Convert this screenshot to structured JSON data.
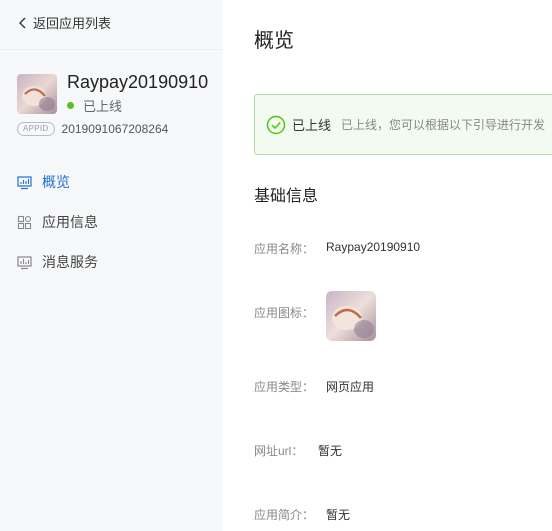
{
  "sidebar": {
    "back_label": "返回应用列表",
    "app_name": "Raypay20190910",
    "status": "已上线",
    "appid_badge": "APPID",
    "appid": "2019091067208264",
    "nav": [
      {
        "label": "概览",
        "active": true,
        "icon": "monitor-icon"
      },
      {
        "label": "应用信息",
        "active": false,
        "icon": "grid-icon"
      },
      {
        "label": "消息服务",
        "active": false,
        "icon": "message-service-icon"
      }
    ]
  },
  "main": {
    "title": "概览",
    "notice": {
      "status": "已上线",
      "description": "已上线，您可以根据以下引导进行开发"
    },
    "section_title": "基础信息",
    "fields": {
      "name_label": "应用名称：",
      "name_value": "Raypay20190910",
      "icon_label": "应用图标：",
      "type_label": "应用类型：",
      "type_value": "网页应用",
      "url_label": "网址url：",
      "url_value": "暂无",
      "intro_label": "应用简介：",
      "intro_value": "暂无"
    }
  },
  "colors": {
    "accent": "#1f6fd6",
    "success": "#52c41a",
    "notice_bg": "#f3faf0",
    "notice_border": "#b5dea2",
    "sidebar_bg": "#f7f8fa"
  }
}
